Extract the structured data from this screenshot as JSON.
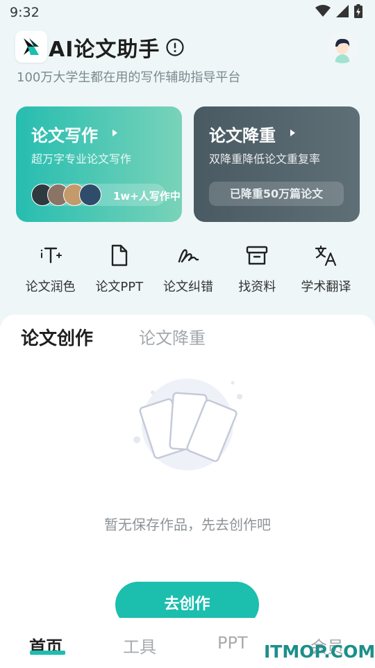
{
  "status": {
    "time": "9:32"
  },
  "header": {
    "title": "AI论文助手",
    "subtitle": "100万大学生都在用的写作辅助指导平台"
  },
  "cards": [
    {
      "title": "论文写作",
      "subtitle": "超万字专业论文写作",
      "badge": "1w+人写作中",
      "color": "#26bdb0"
    },
    {
      "title": "论文降重",
      "subtitle": "双降重降低论文重复率",
      "badge": "已降重50万篇论文",
      "color": "#4a5a63"
    }
  ],
  "tools": [
    {
      "label": "论文润色",
      "icon": "text-format-icon"
    },
    {
      "label": "论文PPT",
      "icon": "document-icon"
    },
    {
      "label": "论文纠错",
      "icon": "handwriting-icon"
    },
    {
      "label": "找资料",
      "icon": "archive-box-icon"
    },
    {
      "label": "学术翻译",
      "icon": "translate-icon"
    }
  ],
  "content": {
    "tabs": [
      "论文创作",
      "论文降重"
    ],
    "active_tab": 0,
    "empty_text": "暂无保存作品，先去创作吧",
    "create_button": "去创作"
  },
  "bottom_nav": {
    "items": [
      "首页",
      "工具",
      "PPT",
      "会员"
    ],
    "active": 0
  },
  "watermark": "ITMOP.COM",
  "colors": {
    "accent": "#1cbeae",
    "dark_card": "#4a5a63"
  }
}
